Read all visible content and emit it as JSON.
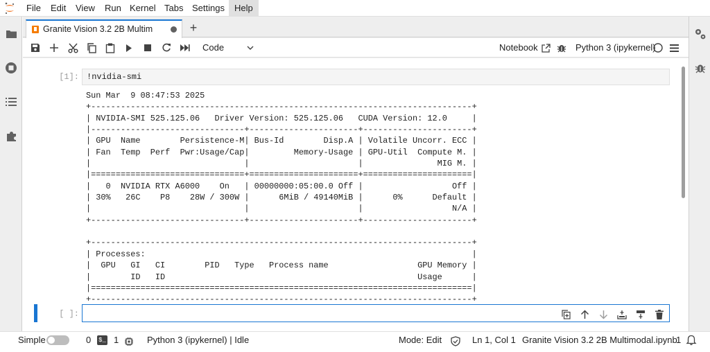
{
  "menubar": {
    "items": [
      "File",
      "Edit",
      "View",
      "Run",
      "Kernel",
      "Tabs",
      "Settings",
      "Help"
    ],
    "active": "Help"
  },
  "tab": {
    "title": "Granite Vision 3.2 2B Multim",
    "new_tab": "+"
  },
  "toolbar": {
    "cell_type": "Code",
    "notebook_label": "Notebook",
    "kernel_name": "Python 3 (ipykernel)"
  },
  "cells": [
    {
      "prompt": "[1]:",
      "code": "!nvidia-smi",
      "output": "Sun Mar  9 08:47:53 2025       \n+-----------------------------------------------------------------------------+\n| NVIDIA-SMI 525.125.06   Driver Version: 525.125.06   CUDA Version: 12.0     |\n|-------------------------------+----------------------+----------------------+\n| GPU  Name        Persistence-M| Bus-Id        Disp.A | Volatile Uncorr. ECC |\n| Fan  Temp  Perf  Pwr:Usage/Cap|         Memory-Usage | GPU-Util  Compute M. |\n|                               |                      |               MIG M. |\n|===============================+======================+======================|\n|   0  NVIDIA RTX A6000    On   | 00000000:05:00.0 Off |                  Off |\n| 30%   26C    P8    28W / 300W |      6MiB / 49140MiB |      0%      Default |\n|                               |                      |                  N/A |\n+-------------------------------+----------------------+----------------------+\n                                                                               \n+-----------------------------------------------------------------------------+\n| Processes:                                                                  |\n|  GPU   GI   CI        PID   Type   Process name                  GPU Memory |\n|        ID   ID                                                   Usage      |\n|=============================================================================|\n+-----------------------------------------------------------------------------+"
    },
    {
      "prompt": "[ ]:",
      "code": ""
    }
  ],
  "statusbar": {
    "mode_label": "Simple",
    "terminals_count": "0",
    "kernels_count": "1",
    "kernel_status": "Python 3 (ipykernel) | Idle",
    "mode": "Mode: Edit",
    "cursor": "Ln 1, Col 1",
    "filename": "Granite Vision 3.2 2B Multimodal.ipynb",
    "notifications": "1"
  },
  "colors": {
    "accent": "#1976d2",
    "notebook_icon": "#f57c00",
    "logo": "#f37726"
  },
  "icons": {
    "left_sidebar": [
      "folder-icon",
      "running-icon",
      "toc-icon",
      "extension-icon"
    ],
    "right_sidebar": [
      "property-inspector-icon",
      "debugger-icon"
    ],
    "toolbar": [
      "save-icon",
      "add-cell-icon",
      "cut-icon",
      "copy-icon",
      "paste-icon",
      "run-icon",
      "stop-icon",
      "restart-icon",
      "fast-forward-icon"
    ],
    "cell_toolbar": [
      "duplicate-icon",
      "move-up-icon",
      "move-down-icon",
      "insert-above-icon",
      "insert-below-icon",
      "delete-icon"
    ]
  }
}
